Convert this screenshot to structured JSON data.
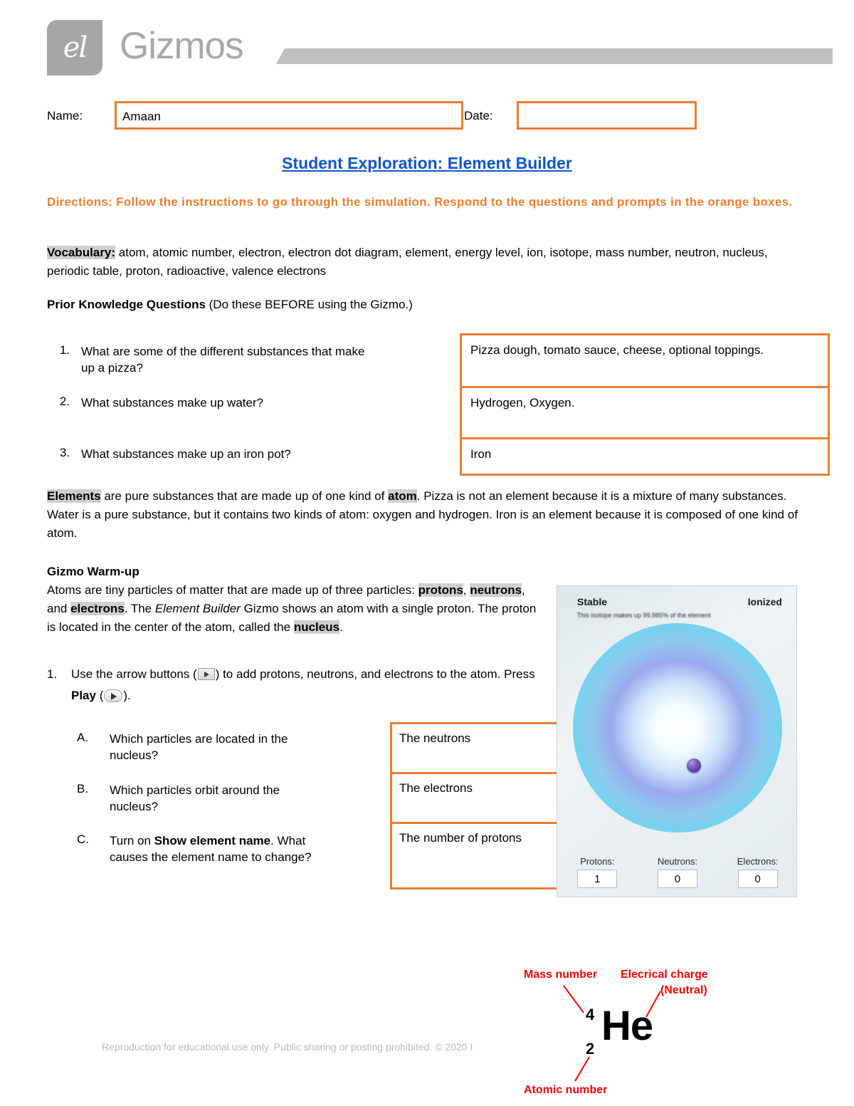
{
  "brand": {
    "logo_glyph": "el",
    "name": "Gizmos"
  },
  "name_date": {
    "name_label": "Name:",
    "name_value": "Amaan",
    "date_label": "Date:",
    "date_value": ""
  },
  "title": "Student Exploration: Element Builder",
  "directions": "Directions: Follow the instructions to go through the simulation. Respond to the questions and prompts in the orange boxes.",
  "vocabulary": {
    "label": "Vocabulary:",
    "terms": " atom, atomic number, electron, electron dot diagram, element, energy level, ion, isotope, mass number, neutron, nucleus, periodic table, proton, radioactive, valence electrons"
  },
  "prior_knowledge": {
    "heading_bold": "Prior Knowledge Questions",
    "heading_rest": " (Do these BEFORE using the Gizmo.)",
    "questions": [
      {
        "num": "1.",
        "text": "What are some of the different substances that make up a pizza?",
        "answer": "Pizza dough, tomato sauce, cheese, optional toppings."
      },
      {
        "num": "2.",
        "text": "What substances make up water?",
        "answer": "Hydrogen, Oxygen."
      },
      {
        "num": "3.",
        "text": "What substances make up an iron pot?",
        "answer": "Iron"
      }
    ]
  },
  "elements_paragraph": {
    "hl1": "Elements",
    "mid1": " are pure substances that are made up of one kind of ",
    "hl2": "atom",
    "rest": ". Pizza is not an element because it is a mixture of many substances. Water is a pure substance, but it contains two kinds of atom: oxygen and hydrogen. Iron is an element because it is composed of one kind of atom."
  },
  "warmup": {
    "heading": "Gizmo Warm-up",
    "line1": "Atoms are tiny particles of matter that are made up of three particles: ",
    "hl_protons": "protons",
    "sep1": ", ",
    "hl_neutrons": "neutrons",
    "sep2": ", and ",
    "hl_electrons": "electrons",
    "mid": ". The ",
    "italic_gizmo": "Element Builder",
    "after_italic": " Gizmo shows an atom with a single proton. The proton is located in the center of the atom, called the ",
    "hl_nucleus": "nucleus",
    "period": "."
  },
  "step1": {
    "num": "1.",
    "part1": "Use the arrow buttons (",
    "part2": ") to add protons, neutrons, and electrons to the atom. Press ",
    "play_bold": "Play",
    "part3": " (",
    "part4": ")."
  },
  "sub_questions": [
    {
      "letter": "A.",
      "text": "Which particles are located in the nucleus?",
      "answer": "The neutrons"
    },
    {
      "letter": "B.",
      "text": "Which particles orbit around the nucleus?",
      "answer": "The electrons"
    },
    {
      "letter": "C.",
      "text_pre": "Turn on ",
      "text_bold": "Show element name",
      "text_post": ". What causes the element name to change?",
      "answer": "The number of protons"
    }
  ],
  "gizmo_panel": {
    "stable_label": "Stable",
    "ionized_label": "Ionized",
    "isotope_note": "This isotope makes up 99.985% of the element",
    "counters": [
      {
        "label": "Protons:",
        "value": "1"
      },
      {
        "label": "Neutrons:",
        "value": "0"
      },
      {
        "label": "Electrons:",
        "value": "0"
      }
    ]
  },
  "helium_diagram": {
    "symbol": "He",
    "mass_number": "4",
    "atomic_number": "2",
    "ann_mass": "Mass number",
    "ann_charge_line1": "Elecrical charge",
    "ann_charge_line2": "(Neutral)",
    "ann_atomic": "Atomic number"
  },
  "footer": "Reproduction for educational use only. Public sharing or posting prohibited. © 2020 I",
  "colors": {
    "orange": "#ED7D31",
    "title_blue": "#1155CC",
    "highlight_gray": "#cfcfcf",
    "annotation_red": "#FF0000"
  }
}
